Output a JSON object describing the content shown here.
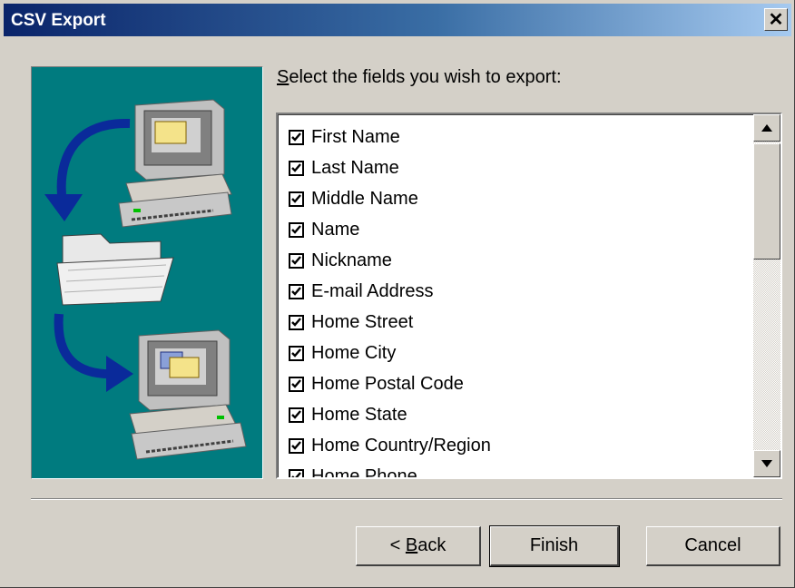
{
  "window": {
    "title": "CSV Export",
    "close_glyph": "✕"
  },
  "prompt": {
    "label": "Select the fields you wish to export:",
    "mnemonic": "S",
    "rest": "elect the fields you wish to export:"
  },
  "fields": [
    {
      "label": "First Name",
      "checked": true
    },
    {
      "label": "Last Name",
      "checked": true
    },
    {
      "label": "Middle Name",
      "checked": true
    },
    {
      "label": "Name",
      "checked": true
    },
    {
      "label": "Nickname",
      "checked": true
    },
    {
      "label": "E-mail Address",
      "checked": true
    },
    {
      "label": "Home Street",
      "checked": true
    },
    {
      "label": "Home City",
      "checked": true
    },
    {
      "label": "Home Postal Code",
      "checked": true
    },
    {
      "label": "Home State",
      "checked": true
    },
    {
      "label": "Home Country/Region",
      "checked": true
    },
    {
      "label": "Home Phone",
      "checked": true
    }
  ],
  "buttons": {
    "back_prefix": "< ",
    "back_mnemonic": "B",
    "back_rest": "ack",
    "finish": "Finish",
    "cancel": "Cancel"
  },
  "colors": {
    "dialog_bg": "#d4d0c8",
    "title_start": "#0a246a",
    "title_end": "#a6caf0",
    "image_bg": "#007b7f"
  }
}
